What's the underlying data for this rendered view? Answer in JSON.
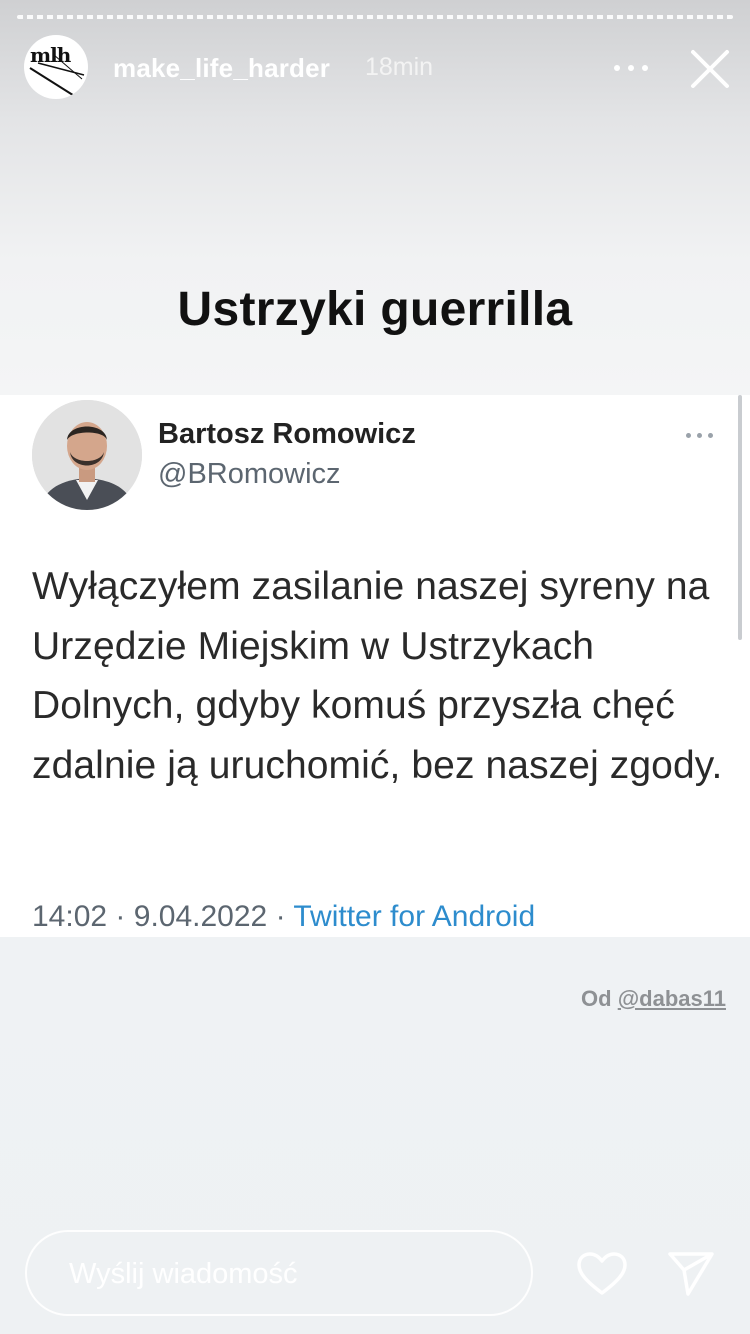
{
  "story": {
    "username": "make_life_harder",
    "time": "18min",
    "avatar_text": "mlh"
  },
  "title": "Ustrzyki guerrilla",
  "tweet": {
    "name": "Bartosz Romowicz",
    "handle": "@BRomowicz",
    "text": "Wyłączyłem zasilanie naszej syreny na Urzędzie Miejskim w Ustrzykach Dolnych, gdyby komuś przyszła chęć zdalnie ją uruchomić, bez naszej zgody.",
    "time": "14:02",
    "date": "9.04.2022",
    "source": "Twitter for Android",
    "separator": "·"
  },
  "credit": {
    "prefix": "Od",
    "user": "@dabas11"
  },
  "reply": {
    "placeholder": "Wyślij wiadomość"
  },
  "colors": {
    "link": "#2d8ccd",
    "title": "#111111"
  }
}
